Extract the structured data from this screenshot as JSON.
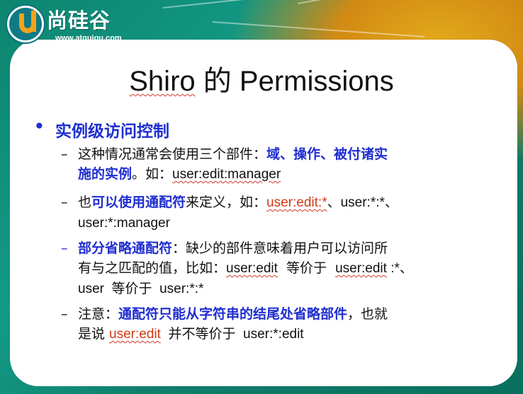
{
  "logo": {
    "name": "尚硅谷",
    "url": "www.atguigu.com"
  },
  "title": {
    "shiro": "Shiro",
    "de": "的",
    "permissions": "Permissions"
  },
  "bullet1": "实例级访问控制",
  "items": [
    {
      "l1a": "这种情况通常会使用三个部件：",
      "l1b": "域、操作、被付诸实",
      "l2a": "施的实例",
      "l2b": "。如：",
      "l2c": "user:edit:manager"
    },
    {
      "l1a": "也",
      "l1b": "可以使用通配符",
      "l1c": "来定义，如：",
      "l1d": "user:edit:*",
      "l1e": "、user:*:*、",
      "l2a": "user:*:manager"
    },
    {
      "l1a": "部分省略通配符",
      "l1b": "：缺少的部件意味着用户可以访问所",
      "l2a": "有与之匹配的值，比如：",
      "l2b": "user:edit",
      "l2c": "  等价于  ",
      "l2d": "user:edit",
      "l2e": " :*、",
      "l3a": "user  等价于  user:*:*"
    },
    {
      "l1a": "注意：",
      "l1b": "通配符只能从字符串的结尾处省略部件",
      "l1c": "，也就",
      "l2a": "是说 ",
      "l2b": "user:edit",
      "l2c": "  并不等价于  user:*:edit"
    }
  ]
}
